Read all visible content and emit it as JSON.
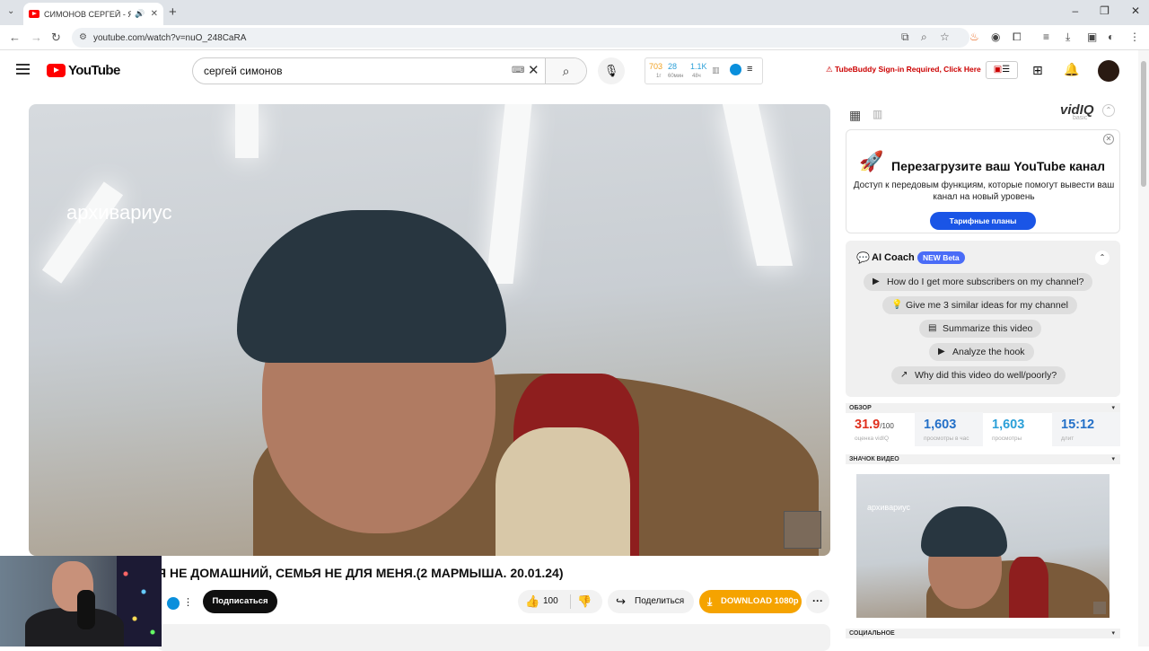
{
  "browser": {
    "tab_title": "СИМОНОВ СЕРГЕЙ - Я НЕ",
    "new_tab": "+",
    "url": "youtube.com/watch?v=nuO_248CaRA",
    "window_controls": [
      "–",
      "❐",
      "✕"
    ]
  },
  "header": {
    "logo_text": "YouTube",
    "search_query": "сергей симонов",
    "stats": [
      {
        "value": "703",
        "sub": "1г",
        "color": "#f0a020"
      },
      {
        "value": "28",
        "sub": "60мин",
        "color": "#2ca0d8"
      },
      {
        "value": "1.1K",
        "sub": "48ч",
        "color": "#2ca0d8"
      }
    ],
    "tubebuddy_notice": "TubeBuddy Sign-in Required, Click Here"
  },
  "video": {
    "watermark": "архивариус",
    "title": "Я НЕ ДОМАШНИЙ, СЕМЬЯ НЕ ДЛЯ МЕНЯ.(2 МАРМЫША. 20.01.24)",
    "subscribe_label": "Подписаться",
    "like_count": "100",
    "share_label": "Поделиться",
    "download_label": "DOWNLOAD 1080p",
    "more_label": "···"
  },
  "vidiq": {
    "logo": "vidIQ",
    "logo_sub": "basic",
    "promo": {
      "title": "Перезагрузите ваш YouTube канал",
      "text": "Доступ к передовым функциям, которые помогут вывести ваш канал на новый уровень",
      "cta": "Тарифные планы"
    },
    "coach": {
      "title": "AI Coach",
      "badge": "NEW Beta",
      "prompts": [
        "How do I get more subscribers on my channel?",
        "Give me 3 similar ideas for my channel",
        "Summarize this video",
        "Analyze the hook",
        "Why did this video do well/poorly?"
      ]
    },
    "overview": {
      "section_label": "ОБЗОР",
      "score": "31.9",
      "score_max": "/100",
      "score_label": "оценка vidIQ",
      "views_per_hour": "1,603",
      "views_per_hour_label": "просмотры в час",
      "views": "1,603",
      "views_label": "просмотры",
      "duration": "15:12",
      "duration_label": "длит"
    },
    "thumbnail_section": "ЗНАЧОК ВИДЕО",
    "social_section": "СОЦИАЛЬНОЕ",
    "thumb_watermark": "архивариус"
  },
  "colors": {
    "youtube_red": "#ff0000",
    "download_orange": "#f5a300",
    "vidiq_blue": "#1a55e6",
    "score_red": "#e0301e"
  }
}
